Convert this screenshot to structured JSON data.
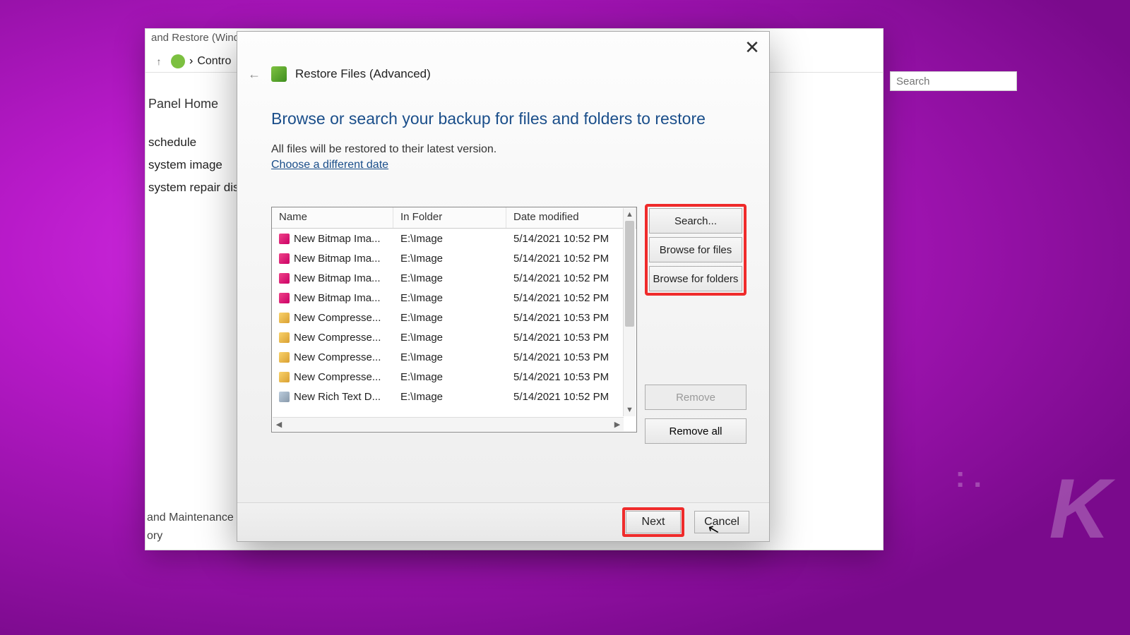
{
  "background_window": {
    "title_partial": "and Restore (Window",
    "breadcrumb": "Contro",
    "panel_home": "Panel Home",
    "links": [
      "schedule",
      "system image",
      "system repair disc"
    ],
    "bottom_links": [
      "and Maintenance",
      "ory"
    ],
    "search_placeholder": "Search"
  },
  "dialog": {
    "title": "Restore Files (Advanced)",
    "heading": "Browse or search your backup for files and folders to restore",
    "subtext": "All files will be restored to their latest version.",
    "link": "Choose a different date",
    "columns": {
      "name": "Name",
      "folder": "In Folder",
      "date": "Date modified"
    },
    "rows": [
      {
        "icon": "bmp",
        "name": "New Bitmap Ima...",
        "folder": "E:\\Image",
        "date": "5/14/2021 10:52 PM"
      },
      {
        "icon": "bmp",
        "name": "New Bitmap Ima...",
        "folder": "E:\\Image",
        "date": "5/14/2021 10:52 PM"
      },
      {
        "icon": "bmp",
        "name": "New Bitmap Ima...",
        "folder": "E:\\Image",
        "date": "5/14/2021 10:52 PM"
      },
      {
        "icon": "bmp",
        "name": "New Bitmap Ima...",
        "folder": "E:\\Image",
        "date": "5/14/2021 10:52 PM"
      },
      {
        "icon": "zip",
        "name": "New Compresse...",
        "folder": "E:\\Image",
        "date": "5/14/2021 10:53 PM"
      },
      {
        "icon": "zip",
        "name": "New Compresse...",
        "folder": "E:\\Image",
        "date": "5/14/2021 10:53 PM"
      },
      {
        "icon": "zip",
        "name": "New Compresse...",
        "folder": "E:\\Image",
        "date": "5/14/2021 10:53 PM"
      },
      {
        "icon": "zip",
        "name": "New Compresse...",
        "folder": "E:\\Image",
        "date": "5/14/2021 10:53 PM"
      },
      {
        "icon": "rtf",
        "name": "New Rich Text D...",
        "folder": "E:\\Image",
        "date": "5/14/2021 10:52 PM"
      }
    ],
    "side_buttons": {
      "search": "Search...",
      "browse_files": "Browse for files",
      "browse_folders": "Browse for folders"
    },
    "remove": "Remove",
    "remove_all": "Remove all",
    "next": "Next",
    "cancel": "Cancel"
  },
  "watermark": "K"
}
